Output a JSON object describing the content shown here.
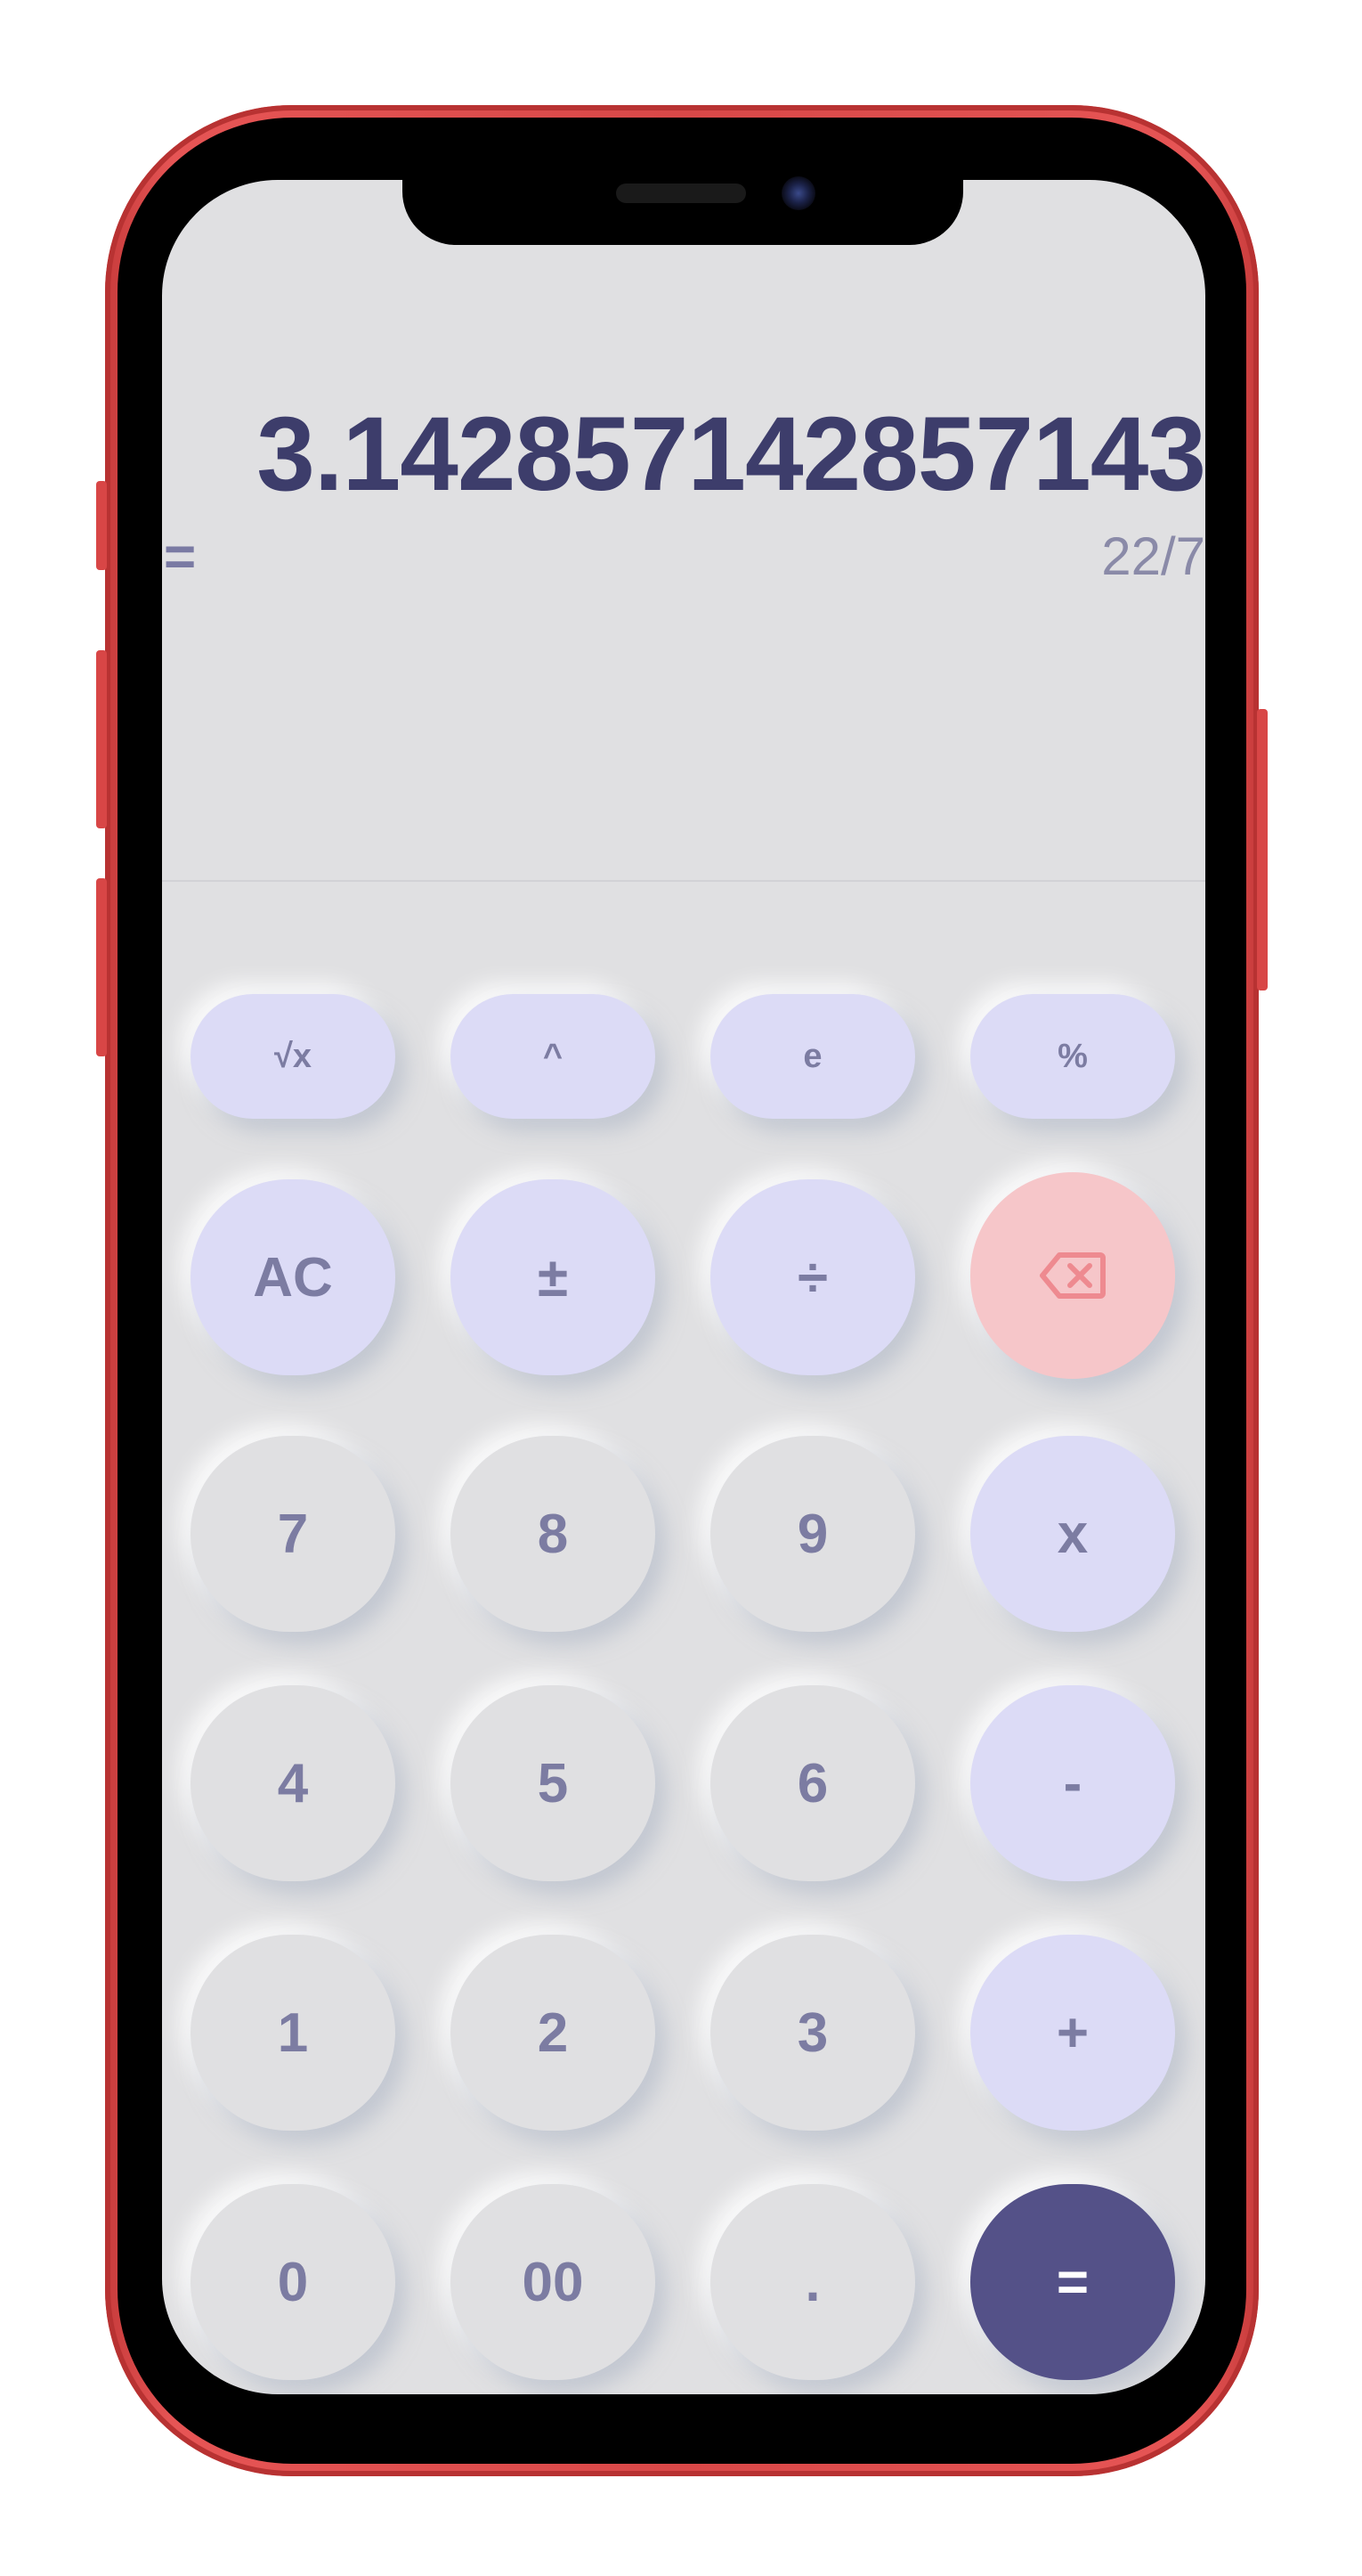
{
  "display": {
    "result": "3.142857142857143",
    "equals_sign": "=",
    "expression": "22/7"
  },
  "keypad": {
    "row1": [
      "√x",
      "^",
      "e",
      "%"
    ],
    "row2": [
      "AC",
      "±",
      "÷",
      "backspace"
    ],
    "row3": [
      "7",
      "8",
      "9",
      "x"
    ],
    "row4": [
      "4",
      "5",
      "6",
      "-"
    ],
    "row5": [
      "1",
      "2",
      "3",
      "+"
    ],
    "row6": [
      "0",
      "00",
      ".",
      "="
    ]
  },
  "icons": {
    "backspace": "backspace-icon"
  },
  "colors": {
    "frame": "#d94848",
    "screen_bg": "#e0e0e2",
    "operator_bg": "#dcdbf6",
    "delete_bg": "#f6c6c9",
    "equals_bg": "#545188",
    "result_text": "#3d3d6b",
    "key_text": "#7c7ca2"
  }
}
